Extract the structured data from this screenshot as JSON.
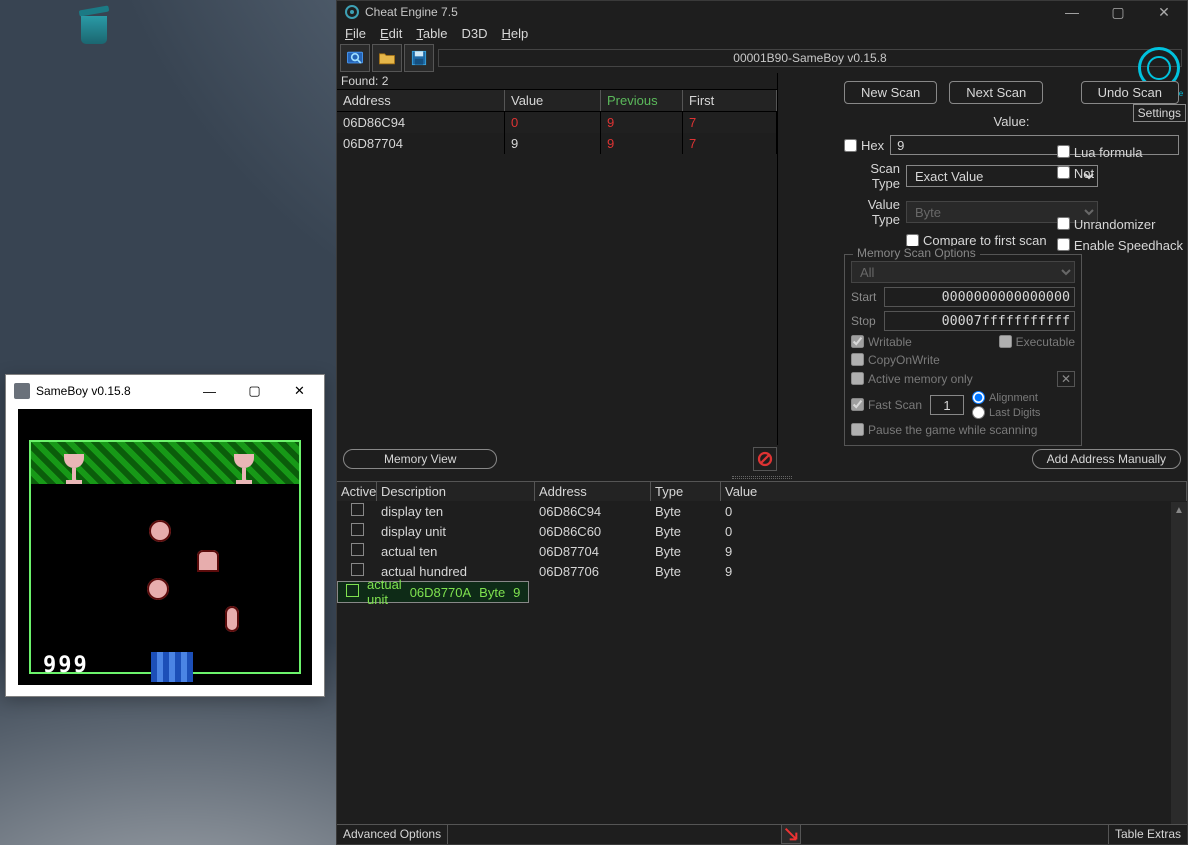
{
  "sameboy": {
    "title": "SameBoy v0.15.8",
    "score": "999"
  },
  "ce": {
    "title": "Cheat Engine 7.5",
    "logo_caption": "Cheat Engine",
    "settings_label": "Settings",
    "menu": {
      "file": "File",
      "edit": "Edit",
      "table": "Table",
      "d3d": "D3D",
      "help": "Help"
    },
    "process": "00001B90-SameBoy v0.15.8",
    "found_label": "Found:",
    "found_count": "2",
    "result_headers": {
      "address": "Address",
      "value": "Value",
      "previous": "Previous",
      "first": "First"
    },
    "results": [
      {
        "address": "06D86C94",
        "value": "0",
        "value_red": true,
        "previous": "9",
        "first": "7"
      },
      {
        "address": "06D87704",
        "value": "9",
        "value_red": false,
        "previous": "9",
        "first": "7"
      }
    ],
    "scan": {
      "new_label": "New Scan",
      "next_label": "Next Scan",
      "undo_label": "Undo Scan",
      "value_label": "Value:",
      "hex_label": "Hex",
      "value": "9",
      "scantype_label": "Scan Type",
      "scantype": "Exact Value",
      "valuetype_label": "Value Type",
      "valuetype": "Byte",
      "lua_label": "Lua formula",
      "not_label": "Not",
      "compare_first_label": "Compare to first scan",
      "unrandomizer_label": "Unrandomizer",
      "speedhack_label": "Enable Speedhack",
      "mscan_legend": "Memory Scan Options",
      "mscan_preset": "All",
      "start_label": "Start",
      "start": "0000000000000000",
      "stop_label": "Stop",
      "stop": "00007fffffffffff",
      "writable_label": "Writable",
      "executable_label": "Executable",
      "cow_label": "CopyOnWrite",
      "activeonly_label": "Active memory only",
      "fastscan_label": "Fast Scan",
      "fastscan_val": "1",
      "alignment_label": "Alignment",
      "lastdigits_label": "Last Digits",
      "pause_label": "Pause the game while scanning"
    },
    "mid": {
      "memview": "Memory View",
      "addman": "Add Address Manually"
    },
    "cheat_headers": {
      "active": "Active",
      "desc": "Description",
      "addr": "Address",
      "type": "Type",
      "value": "Value"
    },
    "cheat_rows": [
      {
        "desc": "display ten",
        "addr": "06D86C94",
        "type": "Byte",
        "value": "0",
        "selected": false
      },
      {
        "desc": "display unit",
        "addr": "06D86C60",
        "type": "Byte",
        "value": "0",
        "selected": false
      },
      {
        "desc": "actual ten",
        "addr": "06D87704",
        "type": "Byte",
        "value": "9",
        "selected": false
      },
      {
        "desc": "actual hundred",
        "addr": "06D87706",
        "type": "Byte",
        "value": "9",
        "selected": false
      },
      {
        "desc": "actual unit",
        "addr": "06D8770A",
        "type": "Byte",
        "value": "9",
        "selected": true
      }
    ],
    "status": {
      "adv": "Advanced Options",
      "extras": "Table Extras"
    }
  }
}
